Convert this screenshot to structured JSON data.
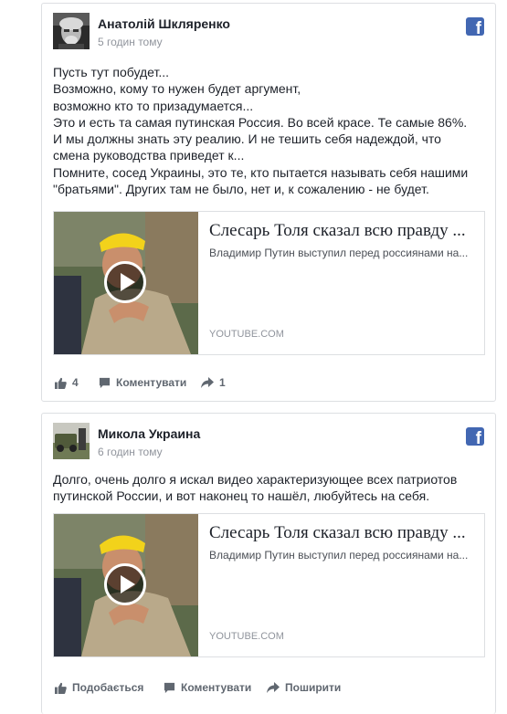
{
  "colors": {
    "facebook_blue": "#4267b2",
    "secondary_text": "#90949c",
    "action_text": "#606770"
  },
  "posts": [
    {
      "author": "Анатолій Шкляренко",
      "time": "5 годин тому",
      "lines": [
        "Пусть тут побудет...",
        "Возможно, кому то нужен будет аргумент,",
        "возможно кто то призадумается...",
        "Это и есть та самая путинская Россия. Во всей красе. Те самые 86%.",
        "И мы должны знать эту реалию. И не тешить себя надеждой, что",
        "смена руководства приведет к...",
        "Помните, сосед Украины, это те, кто пытается называть себя нашими",
        "\"братьями\". Других там не было, нет и, к сожалению - не будет."
      ],
      "preview": {
        "title": "Слесарь Толя сказал всю правду ...",
        "description": "Владимир Путин выступил перед россиянами на...",
        "source": "YOUTUBE.COM"
      },
      "actions": {
        "like": "4",
        "comment": "Коментувати",
        "share": "1"
      }
    },
    {
      "author": "Микола Украина",
      "time": "6 годин тому",
      "lines": [
        "Долго, очень долго я искал видео характеризующее всех патриотов",
        "путинской России, и вот наконец то нашёл, любуйтесь на себя."
      ],
      "preview": {
        "title": "Слесарь Толя сказал всю правду ...",
        "description": "Владимир Путин выступил перед россиянами на...",
        "source": "YOUTUBE.COM"
      },
      "actions": {
        "like": "Подобається",
        "comment": "Коментувати",
        "share": "Поширити"
      }
    }
  ]
}
